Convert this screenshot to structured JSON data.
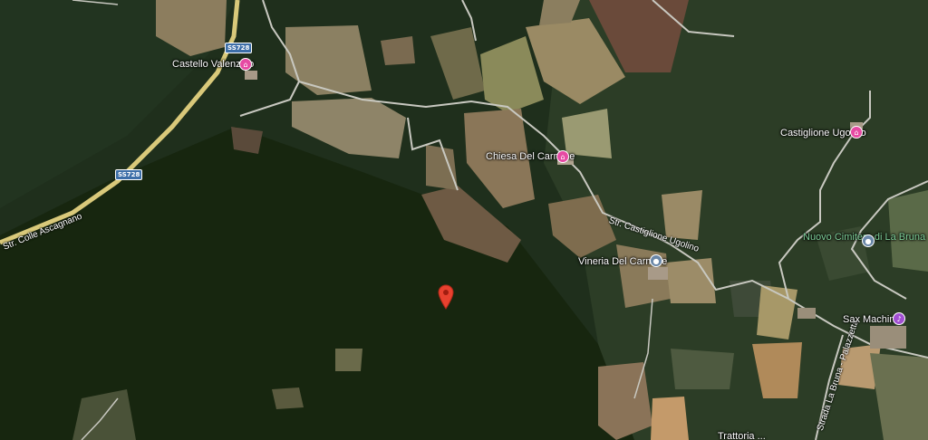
{
  "map": {
    "view": "satellite",
    "marker_color": "#e8412f",
    "places": [
      {
        "name": "Castello Valenzino",
        "icon": "hotel-icon",
        "color": "#e64aa3"
      },
      {
        "name": "Chiesa Del Carmine",
        "icon": "hotel-icon",
        "color": "#e64aa3"
      },
      {
        "name": "Castiglione Ugolino",
        "icon": "hotel-icon",
        "color": "#e64aa3"
      },
      {
        "name": "Vineria Del Carmine",
        "icon": "place-icon",
        "color": "#6a87a8"
      },
      {
        "name": "Nuovo Cimitero di La Bruna",
        "icon": "place-icon",
        "color": "#6a87a8"
      },
      {
        "name": "Sax Machine",
        "icon": "shop-icon",
        "color": "#a14fd1"
      }
    ],
    "roads": [
      {
        "name": "Str. Castiglione Ugolino"
      },
      {
        "name": "Str. Colle Ascagnano"
      },
      {
        "name": "Strada La Bruna - Palazzetta"
      }
    ],
    "road_shields": [
      "SS728",
      "SS728"
    ],
    "partial_label": "Trattoria ..."
  }
}
